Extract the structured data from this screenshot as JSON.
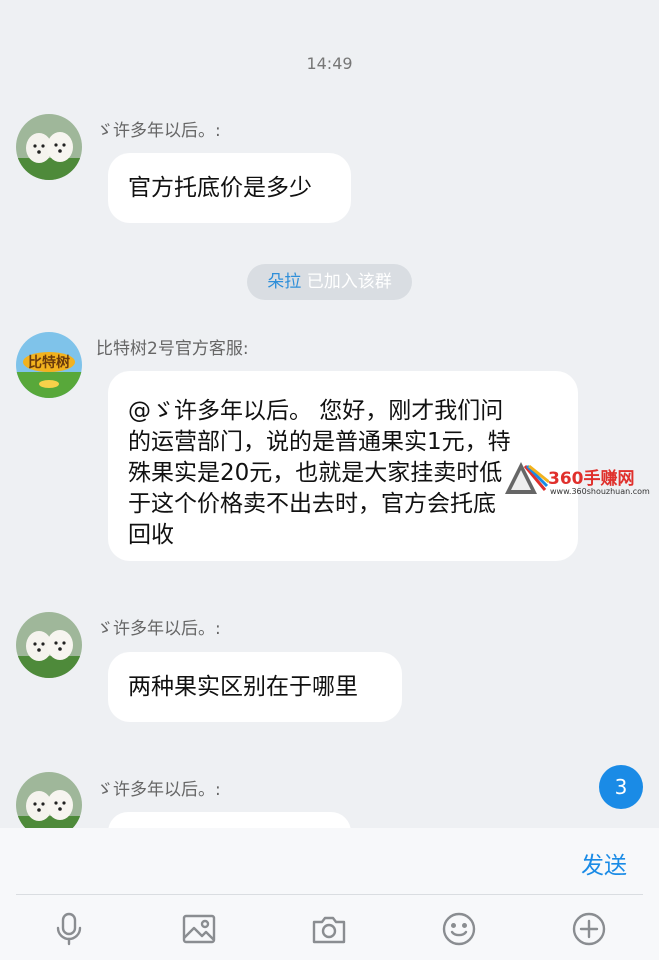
{
  "timestamp": "14:49",
  "messages": [
    {
      "sender": "ゞ许多年以后。:",
      "text": "官方托底价是多少"
    },
    {
      "sender": "比特树2号官方客服:",
      "lines": [
        "@ゞ许多年以后。 您好，刚才我们问",
        "的运营部门，说的是普通果实1元，特",
        "殊果实是20元，也就是大家挂卖时低",
        "于这个价格卖不出去时，官方会托底",
        "回收"
      ]
    },
    {
      "sender": "ゞ许多年以后。:",
      "text": "两种果实区别在于哪里"
    },
    {
      "sender": "ゞ许多年以后。:"
    }
  ],
  "system_notice": {
    "name": "朵拉",
    "text": " 已加入该群"
  },
  "group_avatar_text": "比特树",
  "watermark": {
    "title": "360手赚网",
    "url": "www.360shouzhuan.com"
  },
  "unread_count": "3",
  "composer": {
    "send_label": "发送"
  },
  "toolbar": {
    "icons": [
      "microphone-icon",
      "image-icon",
      "camera-icon",
      "emoji-icon",
      "plus-icon"
    ]
  },
  "colors": {
    "accent": "#1a8be6",
    "background": "#eef0f3",
    "bubble": "#ffffff",
    "notice_bg": "#d9dde2"
  }
}
